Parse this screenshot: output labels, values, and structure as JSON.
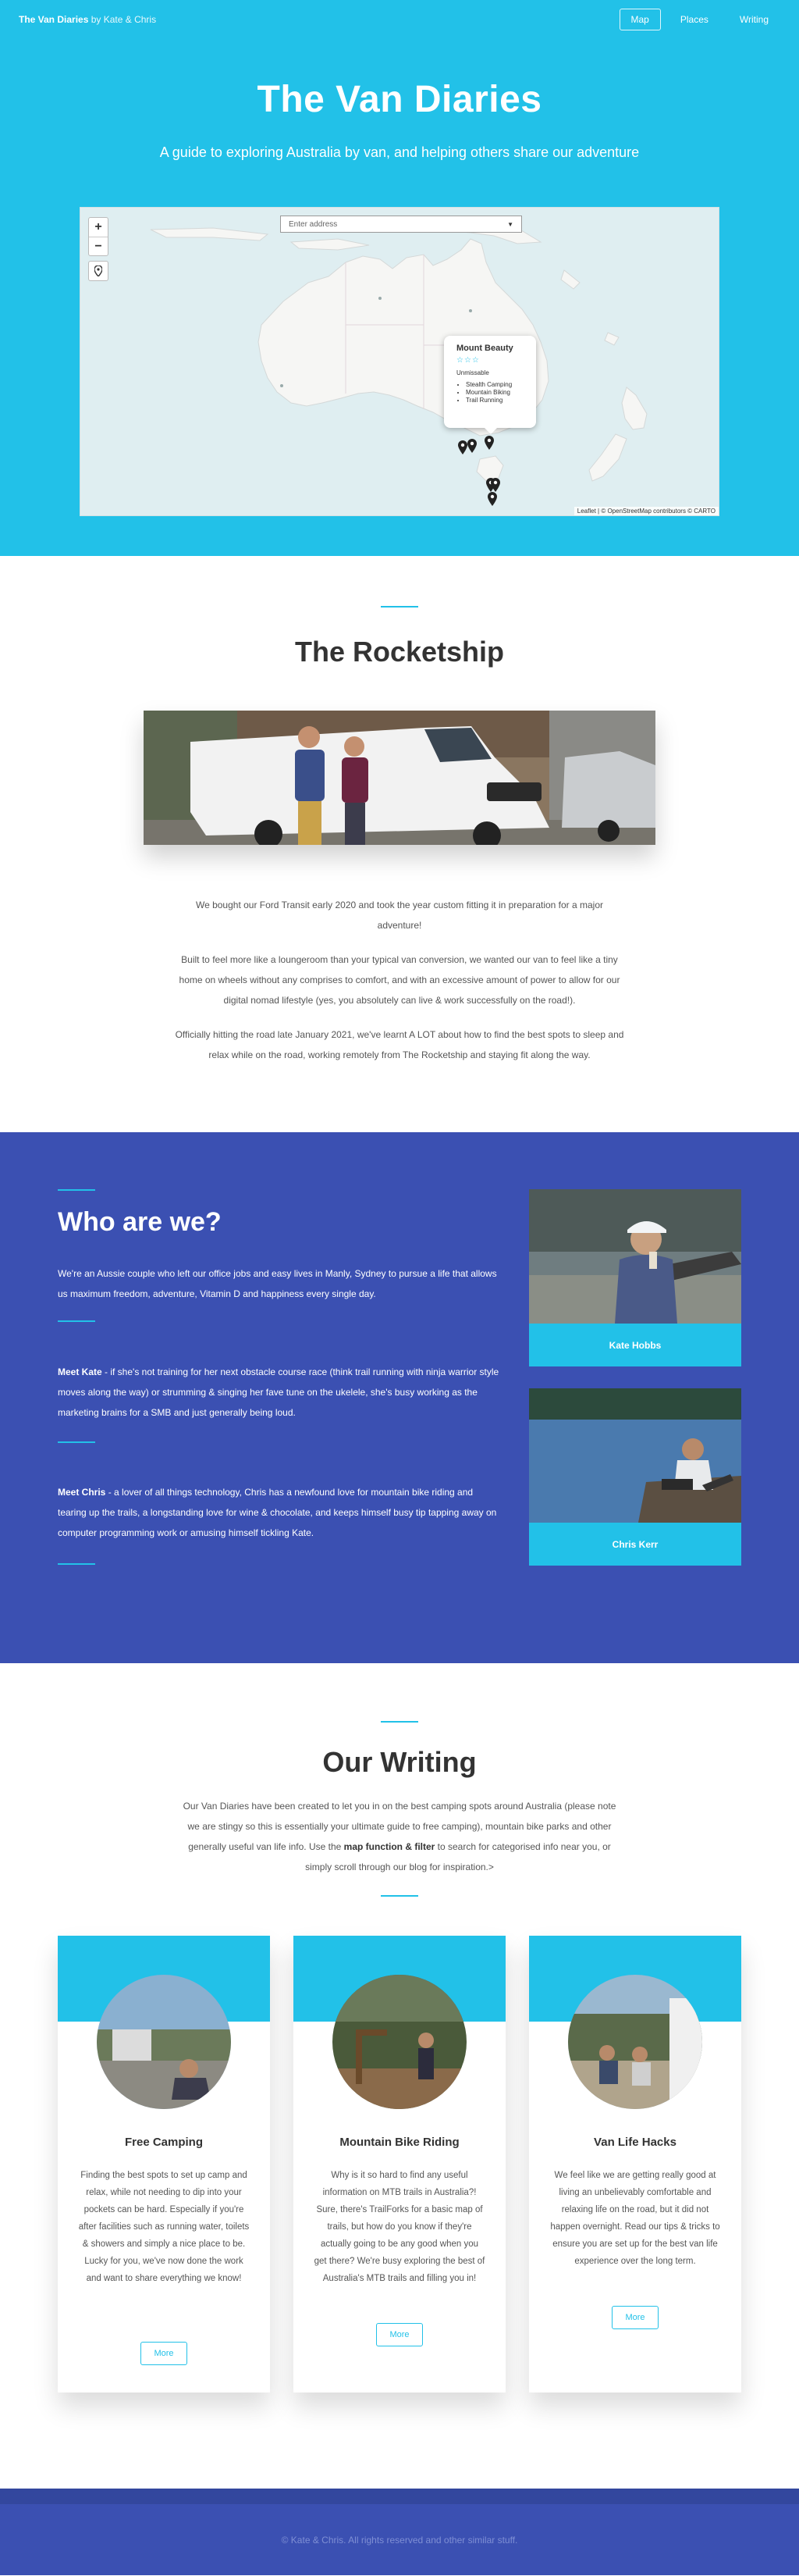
{
  "nav": {
    "brand_name": "The Van Diaries",
    "brand_by": "by Kate & Chris",
    "links": [
      "Map",
      "Places",
      "Writing"
    ]
  },
  "hero": {
    "title": "The Van Diaries",
    "subtitle": "A guide to exploring Australia by van, and helping others share our adventure"
  },
  "map": {
    "zoom_in": "+",
    "zoom_out": "−",
    "address_placeholder": "Enter address",
    "popup": {
      "title": "Mount Beauty",
      "stars": "☆☆☆",
      "description": "Unmissable",
      "activities": [
        "Stealth Camping",
        "Mountain Biking",
        "Trail Running"
      ]
    },
    "attribution": "Leaflet | © OpenStreetMap contributors © CARTO"
  },
  "rocketship": {
    "title": "The Rocketship",
    "paragraphs": [
      "We bought our Ford Transit early 2020 and took the year custom fitting it in preparation for a major adventure!",
      "Built to feel more like a loungeroom than your typical van conversion, we wanted our van to feel like a tiny home on wheels without any comprises to comfort, and with an excessive amount of power to allow for our digital nomad lifestyle (yes, you absolutely can live & work successfully on the road!).",
      "Officially hitting the road late January 2021, we've learnt A LOT about how to find the best spots to sleep and relax while on the road, working remotely from The Rocketship and staying fit along the way."
    ]
  },
  "who": {
    "title": "Who are we?",
    "intro": "We're an Aussie couple who left our office jobs and easy lives in Manly, Sydney to pursue a life that allows us maximum freedom, adventure, Vitamin D and happiness every single day.",
    "kate_label": "Meet Kate",
    "kate_text": " - if she's not training for her next obstacle course race (think trail running with ninja warrior style moves along the way) or strumming & singing her fave tune on the ukelele, she's busy working as the marketing brains for a SMB and just generally being loud.",
    "chris_label": "Meet Chris",
    "chris_text": " - a lover of all things technology, Chris has a newfound love for mountain bike riding and tearing up the trails, a longstanding love for wine & chocolate, and keeps himself busy tip tapping away on computer programming work or amusing himself tickling Kate.",
    "people": [
      "Kate Hobbs",
      "Chris Kerr"
    ]
  },
  "writing": {
    "title": "Our Writing",
    "intro_a": "Our Van Diaries have been created to let you in on the best camping spots around Australia (please note we are stingy so this is essentially your ultimate guide to free camping), mountain bike parks and other generally useful van life info. Use the ",
    "intro_bold": "map function & filter",
    "intro_b": " to search for categorised info near you, or simply scroll through our blog for inspiration.>",
    "cards": [
      {
        "title": "Free Camping",
        "body": "Finding the best spots to set up camp and relax, while not needing to dip into your pockets can be hard. Especially if you're after facilities such as running water, toilets & showers and simply a nice place to be. Lucky for you, we've now done the work and want to share everything we know!",
        "button": "More"
      },
      {
        "title": "Mountain Bike Riding",
        "body": "Why is it so hard to find any useful information on MTB trails in Australia?! Sure, there's TrailForks for a basic map of trails, but how do you know if they're actually going to be any good when you get there? We're busy exploring the best of Australia's MTB trails and filling you in!",
        "button": "More"
      },
      {
        "title": "Van Life Hacks",
        "body": "We feel like we are getting really good at living an unbelievably comfortable and relaxing life on the road, but it did not happen overnight. Read our tips & tricks to ensure you are set up for the best van life experience over the long term.",
        "button": "More"
      }
    ]
  },
  "footer": {
    "text": "© Kate & Chris. All rights reserved and other similar stuff."
  },
  "colors": {
    "cyan": "#22c1e8",
    "indigo": "#3b50b2",
    "footer_band": "#33479e"
  }
}
